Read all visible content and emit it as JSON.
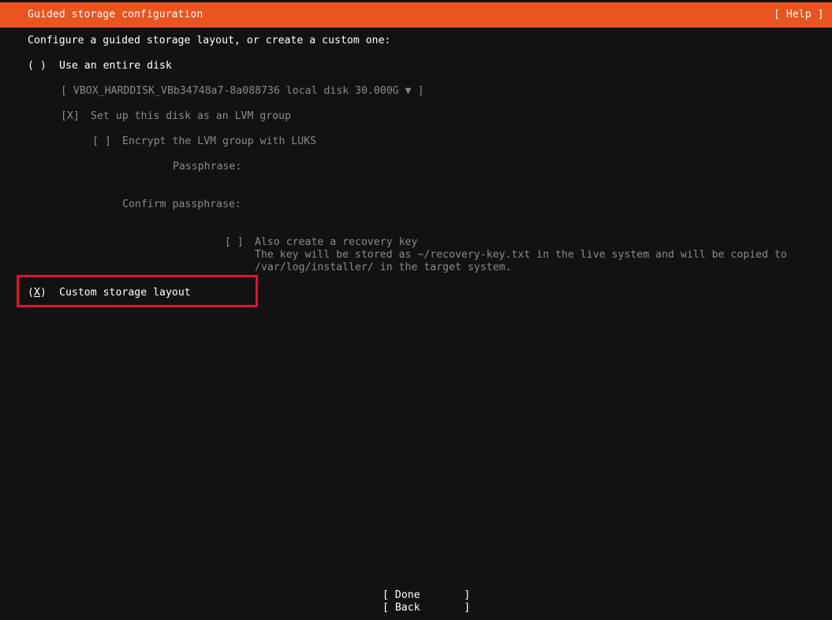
{
  "header": {
    "title": "Guided storage configuration",
    "help_label": "[ Help ]"
  },
  "intro": "Configure a guided storage layout, or create a custom one:",
  "entire_disk": {
    "radio": "( )",
    "label": "Use an entire disk",
    "disk_select": "[ VBOX_HARDDISK_VBb34748a7-8a088736 local disk 30.000G ▼ ]",
    "lvm_checkbox": "[X]",
    "lvm_label": "Set up this disk as an LVM group",
    "encrypt_checkbox": "[ ]",
    "encrypt_label": "Encrypt the LVM group with LUKS",
    "passphrase_label": "Passphrase:",
    "confirm_passphrase_label": "Confirm passphrase:",
    "recovery_checkbox": "[ ]",
    "recovery_label": "Also create a recovery key",
    "recovery_note_1": "The key will be stored as ~/recovery-key.txt in the live system and will be copied to",
    "recovery_note_2": "/var/log/installer/ in the target system."
  },
  "custom_layout": {
    "radio_open": "(",
    "radio_mark": "X",
    "radio_close": ")",
    "label": "Custom storage layout"
  },
  "buttons": {
    "done": "[ Done       ]",
    "back": "[ Back       ]"
  },
  "colors": {
    "header_bg": "#e95420",
    "highlight_border": "#e0152b",
    "background": "#121212",
    "disabled_text": "#8a8a8a"
  }
}
